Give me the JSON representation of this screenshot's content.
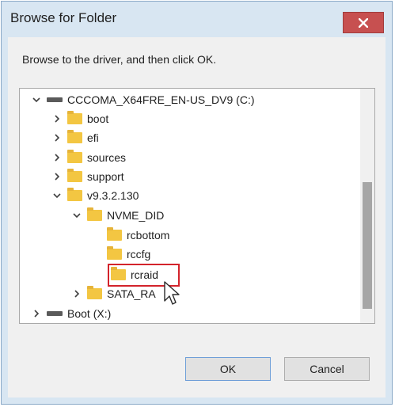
{
  "window": {
    "title": "Browse for Folder",
    "close_icon": "close-icon"
  },
  "instruction": "Browse to the driver, and then click OK.",
  "tree": {
    "items": [
      {
        "label": "CCCOMA_X64FRE_EN-US_DV9 (C:)",
        "icon": "drive-icon",
        "expanded": true
      },
      {
        "label": "boot",
        "icon": "folder-icon",
        "expanded": false
      },
      {
        "label": "efi",
        "icon": "folder-icon",
        "expanded": false
      },
      {
        "label": "sources",
        "icon": "folder-icon",
        "expanded": false
      },
      {
        "label": "support",
        "icon": "folder-icon",
        "expanded": false
      },
      {
        "label": "v9.3.2.130",
        "icon": "folder-icon",
        "expanded": true
      },
      {
        "label": "NVME_DID",
        "icon": "folder-icon",
        "expanded": true
      },
      {
        "label": "rcbottom",
        "icon": "folder-icon"
      },
      {
        "label": "rccfg",
        "icon": "folder-icon"
      },
      {
        "label": "rcraid",
        "icon": "folder-icon",
        "selected": true
      },
      {
        "label": "SATA_RA",
        "icon": "folder-icon",
        "expanded": false
      },
      {
        "label": "Boot (X:)",
        "icon": "drive-icon",
        "expanded": false
      }
    ]
  },
  "buttons": {
    "ok": "OK",
    "cancel": "Cancel"
  },
  "colors": {
    "close_button": "#c75050",
    "highlight_box": "#d3232b",
    "folder": "#f3c642"
  }
}
